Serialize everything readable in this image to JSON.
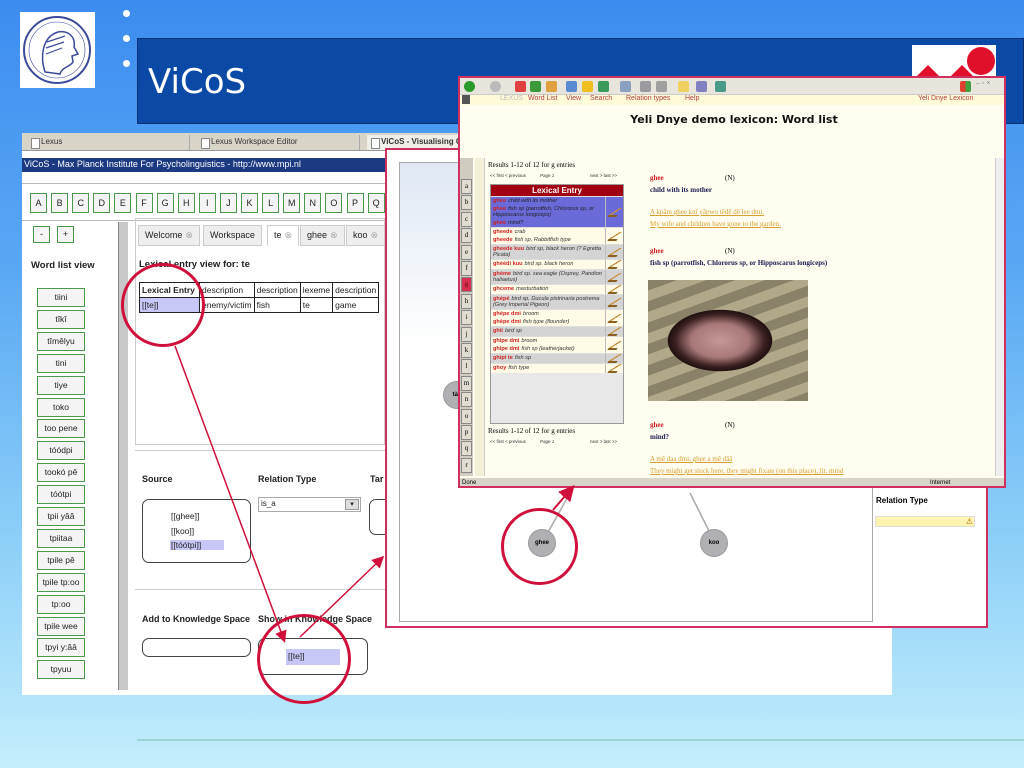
{
  "slide": {
    "title": "ViCoS",
    "accent": "#0a4aa6",
    "annotation_color": "#d0103a"
  },
  "browser_tabs": [
    "Lexus",
    "Lexus Workspace Editor",
    "ViCoS - Visualising C"
  ],
  "app": {
    "title": "ViCoS - Max Planck Institute For Psycholinguistics - http://www.mpi.nl",
    "letters": [
      "A",
      "B",
      "C",
      "D",
      "E",
      "F",
      "G",
      "H",
      "I",
      "J",
      "K",
      "L",
      "M",
      "N",
      "O",
      "P",
      "Q"
    ],
    "zoom_out": "-",
    "zoom_in": "+",
    "word_list_title": "Word list view",
    "words": [
      "tiini",
      "tîkî",
      "tîmêlyu",
      "tini",
      "tiye",
      "toko",
      "too pene",
      "tóódpi",
      "tookó pê",
      "tóótpi",
      "tpii yââ",
      "tpiitaa",
      "tpile pê",
      "tpile tp:oo",
      "tp:oo",
      "tpile wee",
      "tpyi y:ââ",
      "tpyuu"
    ],
    "tabs": [
      {
        "label": "Welcome",
        "close": true
      },
      {
        "label": "Workspace",
        "close": false
      },
      {
        "label": "te",
        "close": true
      },
      {
        "label": "ghee",
        "close": true
      },
      {
        "label": "koo",
        "close": true
      }
    ],
    "entry_view_title": "Lexical entry view for: te",
    "table": {
      "headers": [
        "Lexical Entry",
        "description",
        "description",
        "lexeme",
        "description"
      ],
      "row": [
        "[[te]]",
        "enemy/victim",
        "fish",
        "te",
        "game"
      ]
    },
    "source_label": "Source",
    "relation_label": "Relation Type",
    "target_label": "Tar",
    "sources": [
      "[[ghee]]",
      "[[koo]]",
      "[[tóótpi]]"
    ],
    "relation_value": "is_a",
    "add_label": "Add to Knowledge Space",
    "show_label": "Show in Knowledge Space",
    "show_item": "[[te]]"
  },
  "graph": {
    "nodes": [
      "tàà",
      "ghee",
      "koo"
    ],
    "relation_label": "Relation Type"
  },
  "lexicon": {
    "menu": [
      "Word List",
      "View",
      "Search",
      "Relation types",
      "Help"
    ],
    "brand": "LEXUS",
    "lexicon_name": "Yeli Dnye Lexicon",
    "heading": "Yeli Dnye demo lexicon: Word list",
    "alphabet": [
      "a",
      "b",
      "c",
      "d",
      "e",
      "f",
      "g",
      "h",
      "i",
      "j",
      "k",
      "l",
      "m",
      "n",
      "o",
      "p",
      "q",
      "r"
    ],
    "active_letter": "g",
    "results": "Results 1-12 of 12 for g entries",
    "pager": {
      "prev": "<< first < previous",
      "page": "Page 1",
      "next": "next > last >>"
    },
    "table_header": "Lexical Entry",
    "entries": [
      {
        "style": "blue",
        "lines": [
          [
            "ghee",
            "child with its mother"
          ],
          [
            "ghee",
            "fish sp (parrotfish, Chlororus sp, or Hipposcarus longiceps)"
          ],
          [
            "ghee",
            "mind?"
          ]
        ]
      },
      {
        "style": "cream",
        "lines": [
          [
            "gheede",
            "crab"
          ],
          [
            "gheede",
            "fish sp, Rabbitfish type"
          ]
        ]
      },
      {
        "style": "grey",
        "lines": [
          [
            "gheede kuu",
            "bird sp, black heron (? Egretta Picata)"
          ]
        ]
      },
      {
        "style": "cream",
        "lines": [
          [
            "ghéédi kuu",
            "bird sp. black heron"
          ]
        ]
      },
      {
        "style": "grey",
        "lines": [
          [
            "ghéme",
            "bird sp. sea eagle (Osprey, Pandion haliaetus)"
          ]
        ]
      },
      {
        "style": "cream",
        "lines": [
          [
            "ghceme",
            "masturbation"
          ]
        ]
      },
      {
        "style": "grey",
        "lines": [
          [
            "ghépé",
            "bird sp, Ducula pistrinaria postrema (Grey Imperial Pigeon)"
          ]
        ]
      },
      {
        "style": "cream",
        "lines": [
          [
            "ghèpe dmi",
            "broom"
          ],
          [
            "ghèpe dmi",
            "fish type (flounder)"
          ]
        ]
      },
      {
        "style": "grey",
        "lines": [
          [
            "ghii",
            "bird sp"
          ]
        ]
      },
      {
        "style": "cream",
        "lines": [
          [
            "ghipe dmi",
            "broom"
          ],
          [
            "ghipe dmi",
            "fish sp (leatherjacket)"
          ]
        ]
      },
      {
        "style": "grey",
        "lines": [
          [
            "ghipi te",
            "fish sp"
          ]
        ]
      },
      {
        "style": "cream",
        "lines": [
          [
            "ghoy",
            "fish type"
          ]
        ]
      }
    ],
    "details": [
      {
        "headword": "ghee",
        "pos": "(N)",
        "definition": "child with its mother",
        "examples": [
          "A kpâm ghee knî yâpwo têdê dê lee dmi.",
          "My wife and children have gone to the garden."
        ]
      },
      {
        "headword": "ghee",
        "pos": "(N)",
        "definition": "fish sp (parrotfish, Chlororus sp, or Hipposcarus longiceps)",
        "examples": []
      },
      {
        "headword": "ghee",
        "pos": "(N)",
        "definition": "mind?",
        "examples": [
          "A mê daa dmi, ghee a mê dââ",
          "They might get stuck here, they might fixate (on this place), lit. mind"
        ]
      }
    ],
    "status": "Done",
    "zone": "Internet"
  }
}
